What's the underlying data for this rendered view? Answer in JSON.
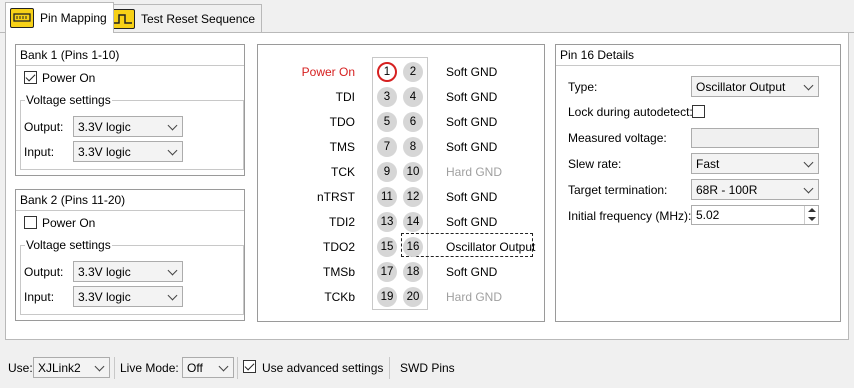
{
  "tabs": [
    {
      "label": "Pin Mapping",
      "icon": "pin-mapping-icon",
      "active": true
    },
    {
      "label": "Test Reset Sequence",
      "icon": "reset-sequence-icon",
      "active": false
    }
  ],
  "bank1": {
    "title": "Bank 1 (Pins 1-10)",
    "power_label": "Power On",
    "power_on": true,
    "voltage_title": "Voltage settings",
    "output_label": "Output:",
    "output_value": "3.3V logic",
    "input_label": "Input:",
    "input_value": "3.3V logic"
  },
  "bank2": {
    "title": "Bank 2 (Pins 11-20)",
    "power_label": "Power On",
    "power_on": false,
    "voltage_title": "Voltage settings",
    "output_label": "Output:",
    "output_value": "3.3V logic",
    "input_label": "Input:",
    "input_value": "3.3V logic"
  },
  "pins": [
    {
      "signal": "Power On",
      "left": "1",
      "right": "2",
      "function": "Soft GND"
    },
    {
      "signal": "TDI",
      "left": "3",
      "right": "4",
      "function": "Soft GND"
    },
    {
      "signal": "TDO",
      "left": "5",
      "right": "6",
      "function": "Soft GND"
    },
    {
      "signal": "TMS",
      "left": "7",
      "right": "8",
      "function": "Soft GND"
    },
    {
      "signal": "TCK",
      "left": "9",
      "right": "10",
      "function": "Hard GND"
    },
    {
      "signal": "nTRST",
      "left": "11",
      "right": "12",
      "function": "Soft GND"
    },
    {
      "signal": "TDI2",
      "left": "13",
      "right": "14",
      "function": "Soft GND"
    },
    {
      "signal": "TDO2",
      "left": "15",
      "right": "16",
      "function": "Oscillator Output"
    },
    {
      "signal": "TMSb",
      "left": "17",
      "right": "18",
      "function": "Soft GND"
    },
    {
      "signal": "TCKb",
      "left": "19",
      "right": "20",
      "function": "Hard GND"
    }
  ],
  "details": {
    "title": "Pin 16 Details",
    "type_label": "Type:",
    "type_value": "Oscillator Output",
    "lock_label": "Lock during autodetect:",
    "measured_label": "Measured voltage:",
    "measured_value": "",
    "slew_label": "Slew rate:",
    "slew_value": "Fast",
    "term_label": "Target termination:",
    "term_value": "68R - 100R",
    "freq_label": "Initial frequency (MHz):",
    "freq_value": "5.02"
  },
  "bottom": {
    "use_label": "Use:",
    "use_value": "XJLink2",
    "live_label": "Live Mode:",
    "live_value": "Off",
    "advanced_label": "Use advanced settings",
    "swd_label": "SWD Pins"
  },
  "colors": {
    "accent_red": "#d62020",
    "tab_icon_yellow": "#f7d117"
  }
}
